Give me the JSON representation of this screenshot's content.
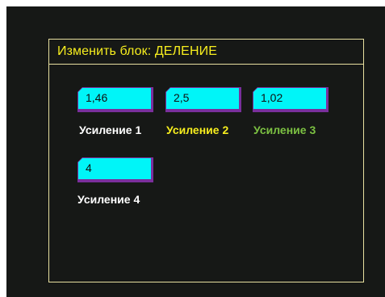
{
  "dialog": {
    "title": "Изменить блок:  ДЕЛЕНИЕ"
  },
  "gains": [
    {
      "value": "1,46",
      "label": "Усиление 1",
      "label_color": "#ffffff"
    },
    {
      "value": "2,5",
      "label": "Усиление 2",
      "label_color": "#f7ee1e"
    },
    {
      "value": "1,02",
      "label": "Усиление 3",
      "label_color": "#7cc142"
    },
    {
      "value": "4",
      "label": "Усиление 4",
      "label_color": "#ffffff"
    }
  ],
  "colors": {
    "field_fill": "#00f5f8",
    "field_border": "#7a2f9c",
    "frame": "#e8e0a0",
    "background": "#161816"
  }
}
